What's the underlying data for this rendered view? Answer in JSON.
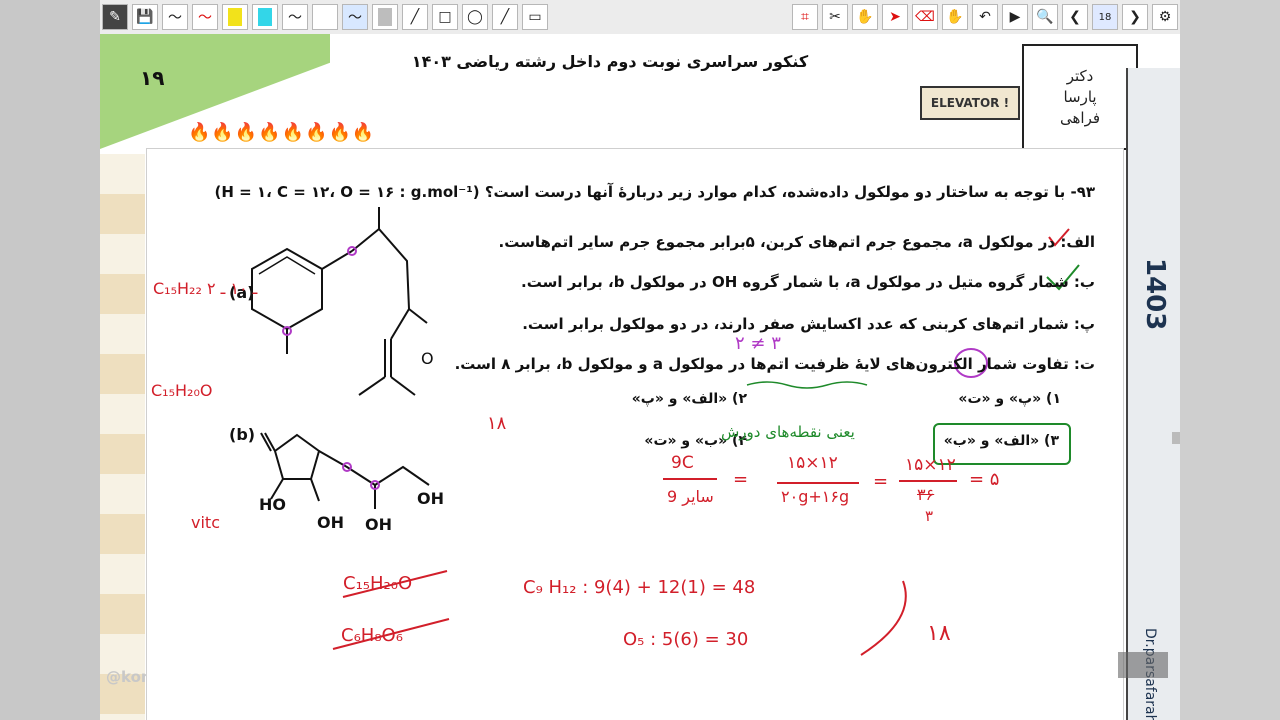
{
  "toolbar": {
    "buttons": [
      {
        "name": "app-logo-icon",
        "glyph": "✎",
        "style": "dark"
      },
      {
        "name": "save-icon",
        "glyph": "💾"
      },
      {
        "name": "pen-black-icon",
        "glyph": "〜"
      },
      {
        "name": "pen-red-icon",
        "glyph": "〜",
        "style": "red"
      },
      {
        "name": "highlighter-yellow-icon",
        "swatch": "#f2e21b"
      },
      {
        "name": "highlighter-cyan-icon",
        "swatch": "#33d6e8"
      },
      {
        "name": "pen-thin-icon",
        "glyph": "〜"
      },
      {
        "name": "blank-tool-icon",
        "glyph": ""
      },
      {
        "name": "pen-purple-icon",
        "glyph": "〜",
        "style": "sel"
      },
      {
        "name": "highlighter-gray-icon",
        "swatch": "#bdbdbd"
      },
      {
        "name": "line-icon",
        "glyph": "╱"
      },
      {
        "name": "rectangle-icon",
        "glyph": "□"
      },
      {
        "name": "ellipse-icon",
        "glyph": "◯"
      },
      {
        "name": "diagonal-line-icon",
        "glyph": "╱"
      },
      {
        "name": "filled-rect-icon",
        "glyph": "▭"
      },
      {
        "name": "crop-icon",
        "glyph": "⌗",
        "style": "red"
      },
      {
        "name": "scissors-icon",
        "glyph": "✂"
      },
      {
        "name": "hand-icon",
        "glyph": "✋",
        "style": "red"
      },
      {
        "name": "pointer-icon",
        "glyph": "➤",
        "style": "red"
      },
      {
        "name": "eraser-icon",
        "glyph": "⌫",
        "style": "red"
      },
      {
        "name": "hand-alt-icon",
        "glyph": "✋",
        "style": "red"
      },
      {
        "name": "undo-icon",
        "glyph": "↶"
      },
      {
        "name": "play-icon",
        "glyph": "▶"
      },
      {
        "name": "search-icon",
        "glyph": "🔍"
      },
      {
        "name": "prev-page-icon",
        "glyph": "❮"
      },
      {
        "name": "page-number",
        "glyph": "18",
        "style": "page"
      },
      {
        "name": "next-page-icon",
        "glyph": "❯"
      },
      {
        "name": "settings-icon",
        "glyph": "⚙"
      }
    ]
  },
  "header": {
    "page_number": "۱۹",
    "exam_title": "کنکور سراسری نوبت دوم داخل رشته ریاضی ۱۴۰۳",
    "elevator_sign": "ELEVATOR !",
    "logo_lines": [
      "دکتر",
      "پارسا",
      "فراهی"
    ]
  },
  "sidebar": {
    "year": "1403",
    "instagram": "Dr.parsafarahi"
  },
  "watermark": "@konkurbanks",
  "question": {
    "header": "۹۳-  با توجه به ساختار دو مولکول داده‌شده، کدام موارد زیر دربارهٔ آنها درست است؟ (H = ۱، C = ۱۲، O = ۱۶ : g.mol⁻¹)",
    "statement_a": "الف: در مولکول a، مجموع جرم اتم‌های کربن، ۵برابر مجموع جرم سایر اتم‌هاست.",
    "statement_b": "ب: شمار گروه متیل در مولکول a، با شمار گروه OH در مولکول b، برابر است.",
    "statement_p": "پ: شمار اتم‌های کربنی که عدد اکسایش صفر دارند، در دو مولکول برابر است.",
    "statement_t": "ت: تفاوت شمار الکترون‌های لایهٔ ظرفیت اتم‌ها در مولکول a و مولکول b، برابر ۸ است.",
    "choices": [
      "۱) «پ» و «ت»",
      "۲) «الف» و «پ»",
      "۳) «الف» و «ب»",
      "۴) «ب» و «ت»"
    ]
  },
  "molecules": {
    "label_a": "(a)",
    "label_b": "(b)",
    "o_label": "O",
    "oh_labels": [
      "HO",
      "OH",
      "OH",
      "OH"
    ]
  },
  "annotations": {
    "formula_a": "C₁₅H₂₂ ـ ۱۰ ـ ۲",
    "formula_a2": "C₁₅H₂₀O",
    "vitc": "vitc",
    "neq": "۲ ≠ ۳",
    "eighteen": "۱۸",
    "meaning": "یعنی نقطه‌های دورش",
    "frac1_num": "9C",
    "frac1_den": "9 سایر",
    "frac2_num": "۱۵×۱۲",
    "frac2_den": "۲۰g+۱۶g",
    "frac3_num": "۱۵×۱۲",
    "frac3_den": "۳۶",
    "frac3_den2": "۳",
    "eq_five": "= ۵",
    "c6_formula": "C₆H₈O₆",
    "sum_line": "C₉  H₁₂  :  9(4) + 12(1) = 48",
    "o5_line": "O₅ :  5(6) = 30",
    "eighteen_b": "۱۸"
  }
}
